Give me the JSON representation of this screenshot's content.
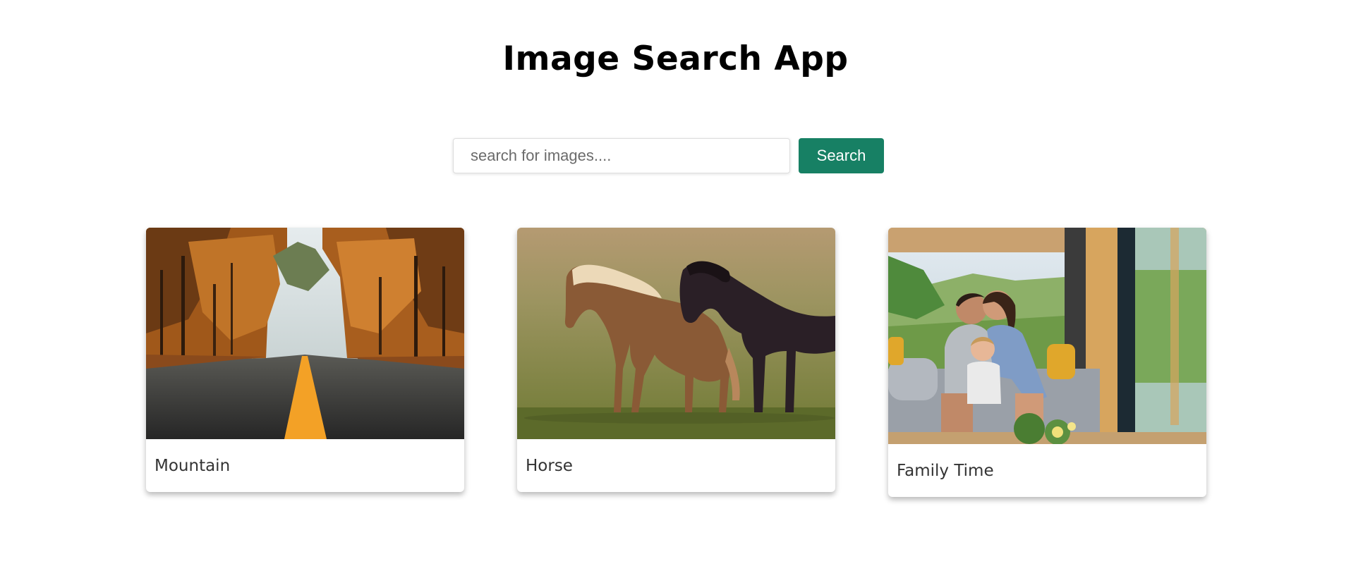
{
  "header": {
    "title": "Image Search App"
  },
  "search": {
    "placeholder": "search for images....",
    "value": "",
    "button_label": "Search",
    "button_color": "#178064"
  },
  "results": [
    {
      "label": "Mountain",
      "image": "autumn-road-photo"
    },
    {
      "label": "Horse",
      "image": "horses-photo"
    },
    {
      "label": "Family Time",
      "image": "family-photo"
    }
  ]
}
